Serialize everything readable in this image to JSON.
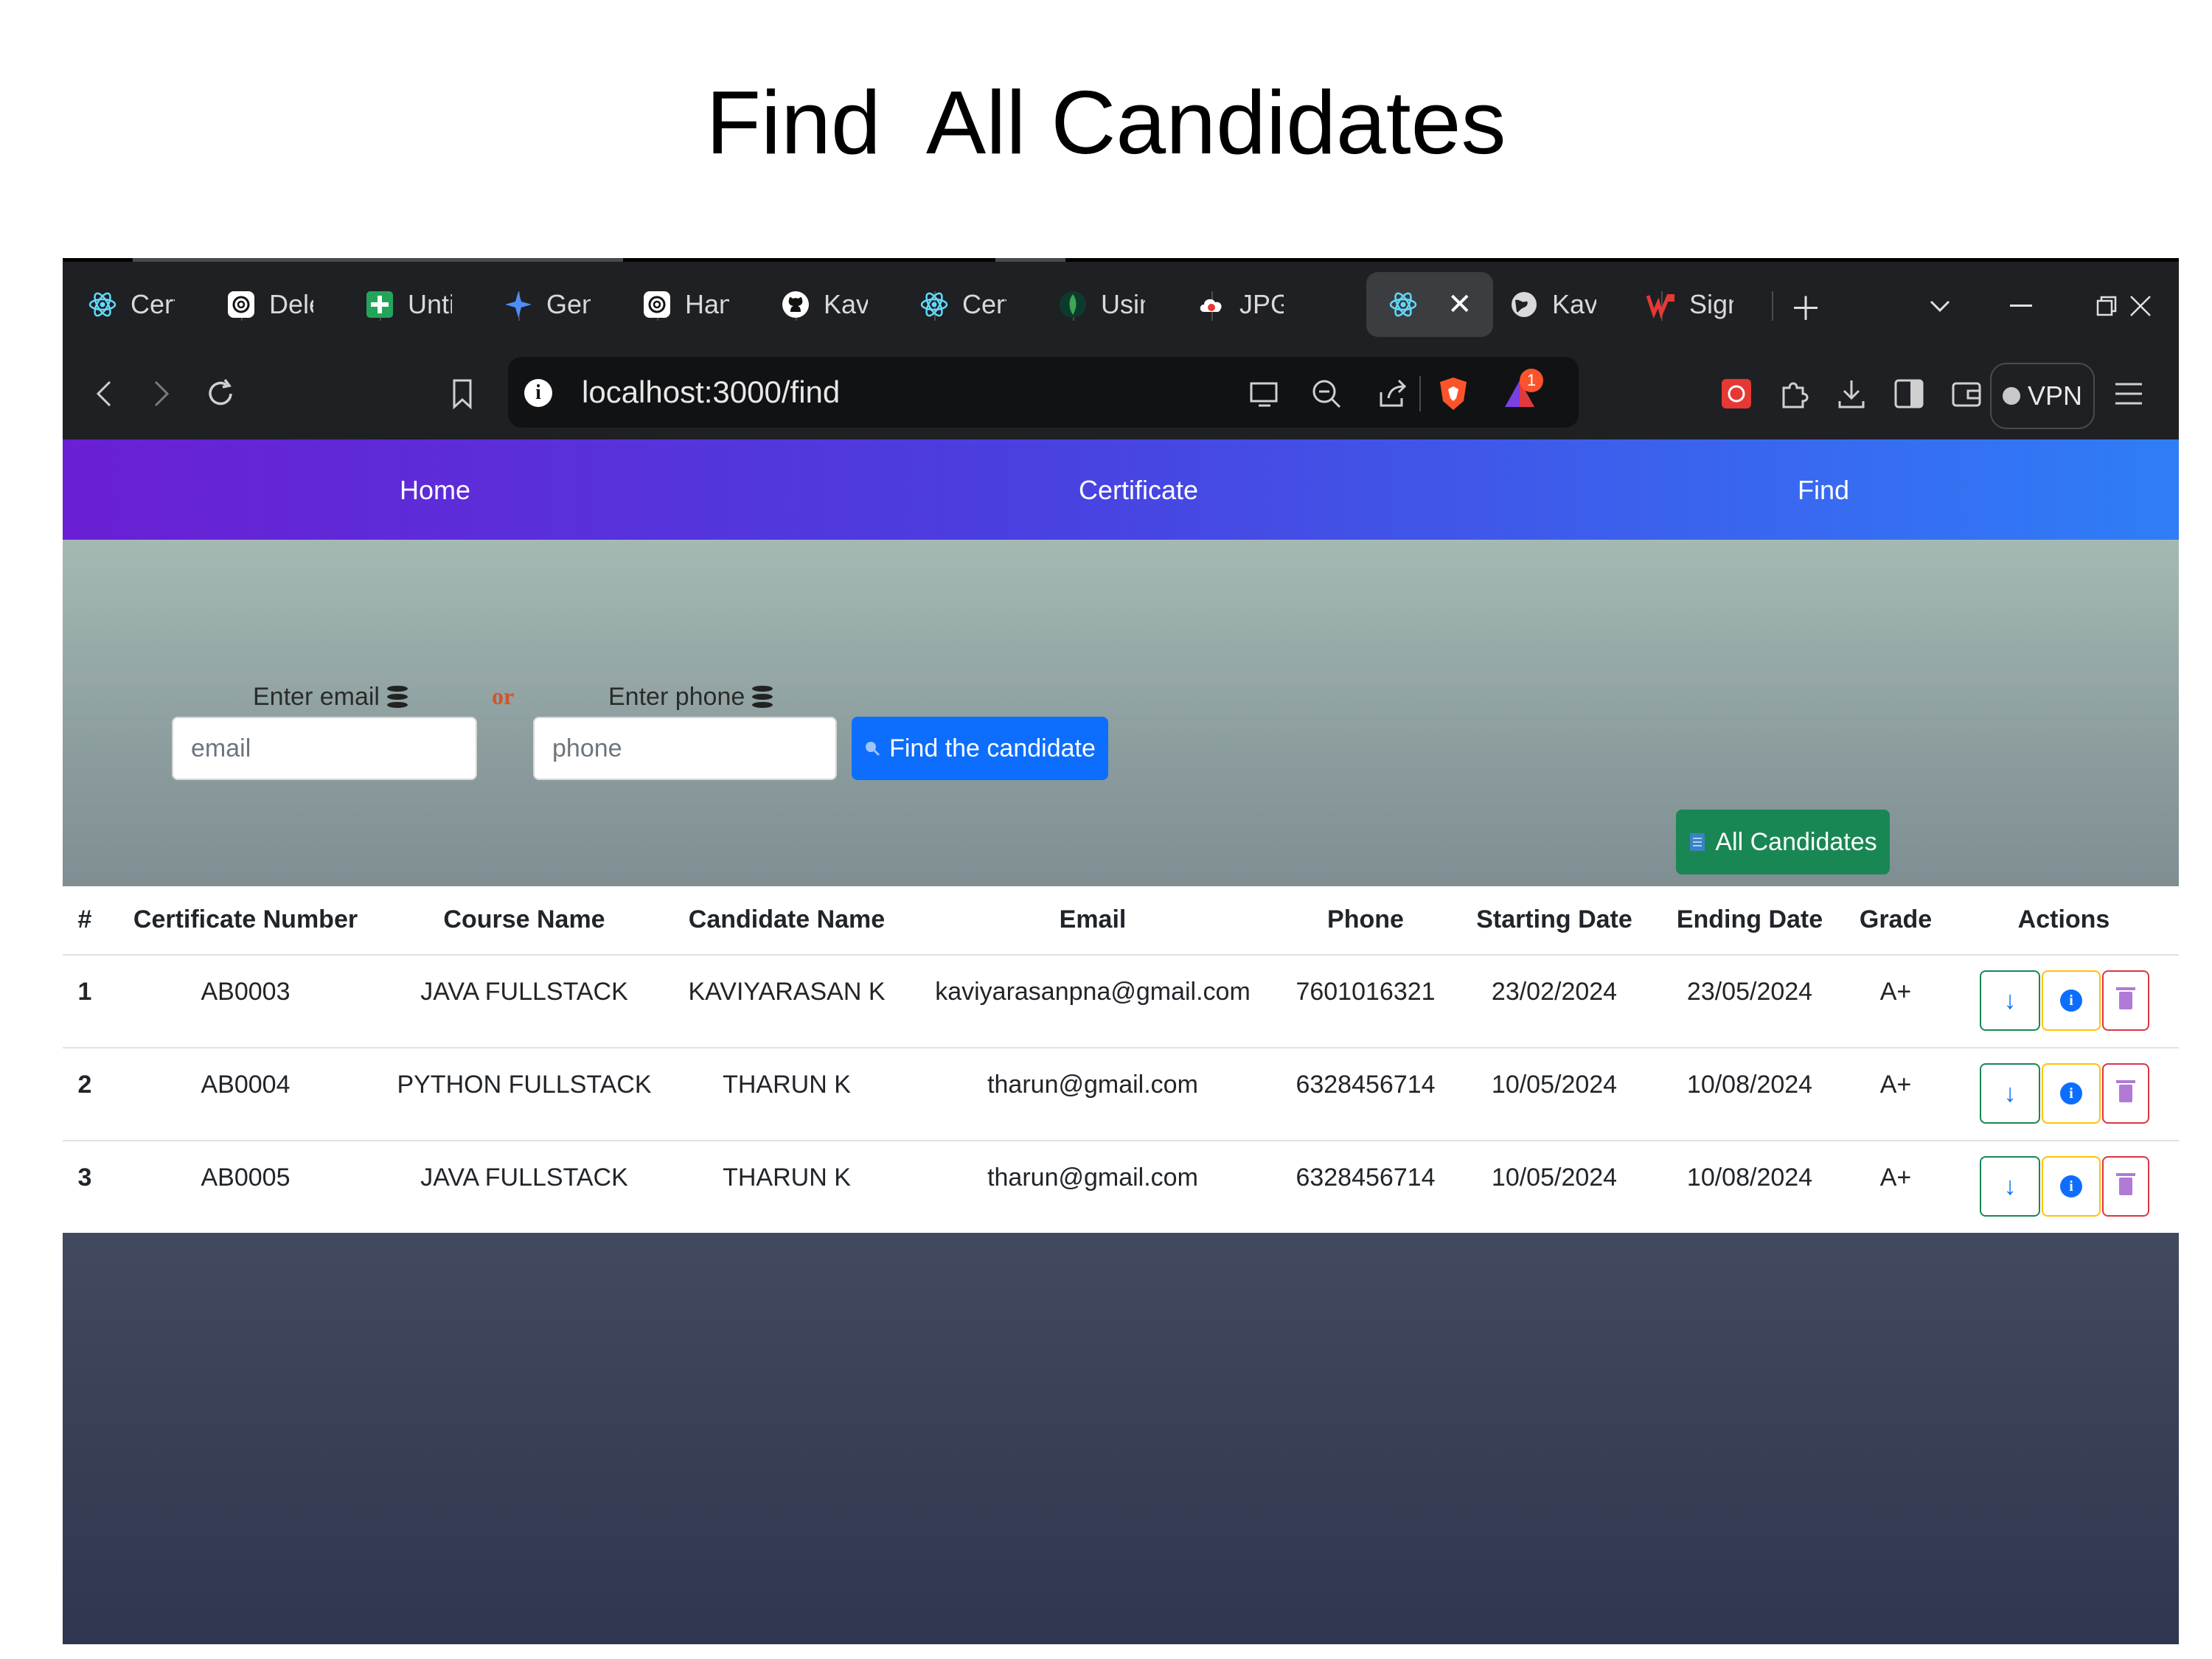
{
  "slide": {
    "title": "Find  All Candidates"
  },
  "browser": {
    "tabs": [
      {
        "icon": "react-icon",
        "label": "Cert"
      },
      {
        "icon": "openai-icon",
        "label": "Dele"
      },
      {
        "icon": "sheets-plus-icon",
        "label": "Unti"
      },
      {
        "icon": "sparkle-icon",
        "label": "Gen"
      },
      {
        "icon": "openai-icon",
        "label": "Han"
      },
      {
        "icon": "github-icon",
        "label": "Kavi"
      },
      {
        "icon": "react-icon",
        "label": "Cert"
      },
      {
        "icon": "mongodb-icon",
        "label": "Usin"
      },
      {
        "icon": "cloud-icon",
        "label": "JPG"
      },
      {
        "icon": "react-icon",
        "label": ""
      },
      {
        "icon": "globe-icon",
        "label": "Kavi"
      },
      {
        "icon": "wps-icon",
        "label": "Sign"
      }
    ],
    "active_tab_index": 9,
    "url": "localhost:3000/find",
    "vpn_label": "VPN",
    "notification_badge": "1"
  },
  "nav": {
    "home": "Home",
    "certificate": "Certificate",
    "find": "Find"
  },
  "search": {
    "email_label": "Enter email",
    "or_label": "or",
    "phone_label": "Enter phone",
    "email_placeholder": "email",
    "phone_placeholder": "phone",
    "find_button": "Find the candidate",
    "all_button": "All Candidates"
  },
  "table": {
    "headers": [
      "#",
      "Certificate Number",
      "Course Name",
      "Candidate Name",
      "Email",
      "Phone",
      "Starting Date",
      "Ending Date",
      "Grade",
      "Actions"
    ],
    "rows": [
      [
        "1",
        "AB0003",
        "JAVA FULLSTACK",
        "KAVIYARASAN K",
        "kaviyarasanpna@gmail.com",
        "7601016321",
        "23/02/2024",
        "23/05/2024",
        "A+"
      ],
      [
        "2",
        "AB0004",
        "PYTHON FULLSTACK",
        "THARUN K",
        "tharun@gmail.com",
        "6328456714",
        "10/05/2024",
        "10/08/2024",
        "A+"
      ],
      [
        "3",
        "AB0005",
        "JAVA FULLSTACK",
        "THARUN K",
        "tharun@gmail.com",
        "6328456714",
        "10/05/2024",
        "10/08/2024",
        "A+"
      ]
    ]
  },
  "colors": {
    "nav_gradient_start": "#6a1fd4",
    "nav_gradient_end": "#2f7df7",
    "primary_button": "#0d6efd",
    "success_button": "#198754"
  }
}
